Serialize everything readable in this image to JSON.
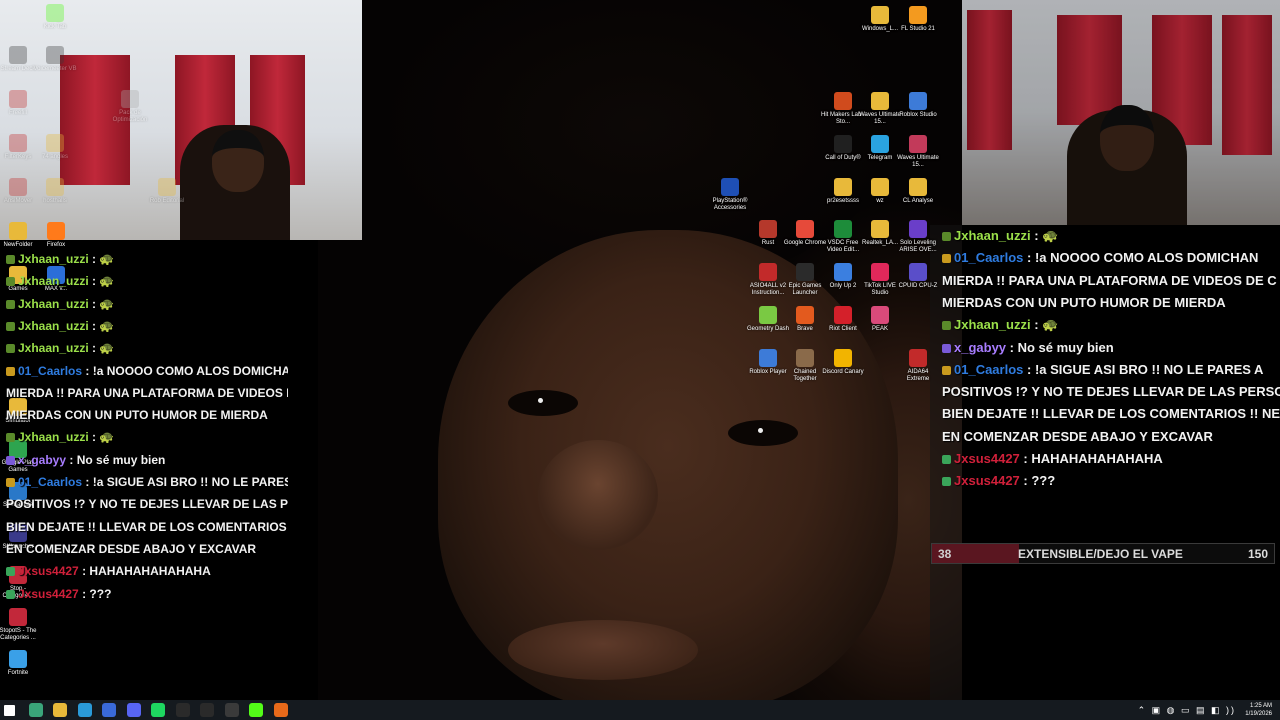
{
  "desktop_icons_top_right": [
    {
      "label": "Windows_L...",
      "color": "#e8b93a"
    },
    {
      "label": "FL Studio 21",
      "color": "#f39a1f"
    },
    {
      "label": "Hit Makers Lab - Sto...",
      "color": "#d04b1d"
    },
    {
      "label": "Waves Ultimate 15...",
      "color": "#e8b93a"
    },
    {
      "label": "Roblox Studio",
      "color": "#3d7bd8"
    },
    {
      "label": "Call of Duty®",
      "color": "#202020"
    },
    {
      "label": "Telegram",
      "color": "#2aa3e0"
    },
    {
      "label": "Waves Ultimate 15...",
      "color": "#c23a5a"
    },
    {
      "label": "PlayStation® Accessories",
      "color": "#1e4fb5"
    },
    {
      "label": "pr2esetssss",
      "color": "#e8b93a"
    },
    {
      "label": "wz",
      "color": "#e8b93a"
    },
    {
      "label": "CL Analyse",
      "color": "#e8b93a"
    },
    {
      "label": "Rust",
      "color": "#b5382b"
    },
    {
      "label": "Google Chrome",
      "color": "#e64a3a"
    },
    {
      "label": "VSDC Free Video Edit...",
      "color": "#1d8c3a"
    },
    {
      "label": "Realtek_LA...",
      "color": "#e8b93a"
    },
    {
      "label": "Solo Leveling ARISE OVE...",
      "color": "#6a3ec9"
    },
    {
      "label": "ASIO4ALL v2 Instruction...",
      "color": "#c22a2a"
    },
    {
      "label": "Epic Games Launcher",
      "color": "#2b2b2b"
    },
    {
      "label": "Only Up 2",
      "color": "#3b7fe0"
    },
    {
      "label": "TikTok LIVE Studio",
      "color": "#e0285a"
    },
    {
      "label": "CPUID CPU-Z",
      "color": "#5a4ec9"
    },
    {
      "label": "Geometry Dash",
      "color": "#7ac943"
    },
    {
      "label": "Brave",
      "color": "#e35a1e"
    },
    {
      "label": "Riot Client",
      "color": "#d4202a"
    },
    {
      "label": "PEAK",
      "color": "#d94a7a"
    },
    {
      "label": "Roblox Player",
      "color": "#3d7bd8"
    },
    {
      "label": "Chained Together",
      "color": "#8a6a4a"
    },
    {
      "label": "Discord Canary",
      "color": "#f2b400"
    },
    {
      "label": "AIDA64 Extreme",
      "color": "#c22a2a"
    }
  ],
  "desktop_icons_left": [
    {
      "label": "NewFolder",
      "color": "#e8b93a"
    },
    {
      "label": "Firefox",
      "color": "#ff7a1a"
    },
    {
      "label": "Games",
      "color": "#e8b93a"
    },
    {
      "label": "MAX v...",
      "color": "#2b6ed8"
    },
    {
      "label": "Simulator",
      "color": "#e8b93a"
    },
    {
      "label": "Google Play Games",
      "color": "#2ea44f"
    },
    {
      "label": "Subnautica",
      "color": "#2a78c8"
    },
    {
      "label": "SKlauncher",
      "color": "#3a3a8a"
    },
    {
      "label": "Stop - Categorie...",
      "color": "#c2283a"
    },
    {
      "label": "StopotS - The Categories ...",
      "color": "#c2283a"
    },
    {
      "label": "Fortnite",
      "color": "#3aa0e8"
    }
  ],
  "room_cam_icons": [
    {
      "label": "Kick Tab",
      "color": "#53fc18"
    },
    {
      "label": "Stream Deck",
      "color": "#3a3a3a"
    },
    {
      "label": "Voicemeeter VB",
      "color": "#3a3a3a"
    },
    {
      "label": "Freefill",
      "color": "#c22a2a"
    },
    {
      "label": "Pack de Optimización",
      "color": "#aaaaaa"
    },
    {
      "label": "FilterKeys",
      "color": "#c22a2a"
    },
    {
      "label": "74 angles",
      "color": "#e8b93a"
    },
    {
      "label": "AnsiMover",
      "color": "#c22a2a"
    },
    {
      "label": "hosthalls",
      "color": "#e8b93a"
    },
    {
      "label": "Rob Editorial",
      "color": "#e8b93a"
    }
  ],
  "chat_left": [
    {
      "user": "Jxhaan_uzzi",
      "color": "u-green",
      "msg": "🐢"
    },
    {
      "user": "Jxhaan_uzzi",
      "color": "u-green",
      "msg": "🐢"
    },
    {
      "user": "Jxhaan_uzzi",
      "color": "u-green",
      "msg": "🐢"
    },
    {
      "user": "Jxhaan_uzzi",
      "color": "u-green",
      "msg": "🐢"
    },
    {
      "user": "Jxhaan_uzzi",
      "color": "u-green",
      "msg": "🐢"
    },
    {
      "user": "01_Caarlos",
      "color": "u-blue",
      "msg": "!a NOOOO COMO ALOS DOMICHAN"
    },
    {
      "user": "",
      "color": "u-blue",
      "msg": "MIERDA !! PARA UNA PLATAFORMA DE VIDEOS DE C"
    },
    {
      "user": "",
      "color": "u-blue",
      "msg": "MIERDAS CON UN PUTO HUMOR DE MIERDA"
    },
    {
      "user": "Jxhaan_uzzi",
      "color": "u-green",
      "msg": "🐢"
    },
    {
      "user": "x_gabyy",
      "color": "u-purple",
      "msg": "No sé muy bien"
    },
    {
      "user": "01_Caarlos",
      "color": "u-blue",
      "msg": "!a SIGUE ASI BRO !! NO LE PARES"
    },
    {
      "user": "",
      "color": "u-blue",
      "msg": "POSITIVOS !? Y NO TE DEJES LLEVAR DE LAS PERSO"
    },
    {
      "user": "",
      "color": "u-blue",
      "msg": "BIEN DEJATE !! LLEVAR DE LOS COMENTARIOS !! NE"
    },
    {
      "user": "",
      "color": "u-blue",
      "msg": "EN COMENZAR DESDE ABAJO Y EXCAVAR"
    },
    {
      "user": "Jxsus4427",
      "color": "u-red",
      "msg": "HAHAHAHAHAHAHA"
    },
    {
      "user": "Jxsus4427",
      "color": "u-red",
      "msg": "???"
    }
  ],
  "chat_right": [
    {
      "user": "Jxhaan_uzzi",
      "color": "u-green",
      "msg": "🐢"
    },
    {
      "user": "01_Caarlos",
      "color": "u-blue",
      "msg": "!a NOOOO COMO ALOS DOMICHAN"
    },
    {
      "user": "",
      "color": "u-blue",
      "msg": "MIERDA !! PARA UNA PLATAFORMA DE VIDEOS DE C"
    },
    {
      "user": "",
      "color": "u-blue",
      "msg": "MIERDAS CON UN PUTO HUMOR DE MIERDA"
    },
    {
      "user": "Jxhaan_uzzi",
      "color": "u-green",
      "msg": "🐢"
    },
    {
      "user": "x_gabyy",
      "color": "u-purple",
      "msg": "No sé muy bien"
    },
    {
      "user": "01_Caarlos",
      "color": "u-blue",
      "msg": "!a SIGUE ASI BRO !! NO LE PARES A"
    },
    {
      "user": "",
      "color": "u-blue",
      "msg": "POSITIVOS !? Y NO TE DEJES LLEVAR DE LAS PERSON"
    },
    {
      "user": "",
      "color": "u-blue",
      "msg": "BIEN DEJATE !! LLEVAR DE LOS COMENTARIOS !! NEG"
    },
    {
      "user": "",
      "color": "u-blue",
      "msg": "EN COMENZAR DESDE ABAJO Y EXCAVAR"
    },
    {
      "user": "Jxsus4427",
      "color": "u-red",
      "msg": "HAHAHAHAHAHAHA"
    },
    {
      "user": "Jxsus4427",
      "color": "u-red",
      "msg": "???"
    }
  ],
  "goal_bar": {
    "current": "38",
    "label": "EXTENSIBLE/DEJO EL VAPE",
    "target": "150",
    "progress_fraction": 0.253
  },
  "taskbar": {
    "icons": [
      {
        "name": "start-icon",
        "color": "#ffffff"
      },
      {
        "name": "terminal-icon",
        "color": "#3aa57a"
      },
      {
        "name": "file-explorer-icon",
        "color": "#e8b93a"
      },
      {
        "name": "edge-icon",
        "color": "#2a9ad8"
      },
      {
        "name": "app-blue-icon",
        "color": "#3a6ad8"
      },
      {
        "name": "discord-icon",
        "color": "#5865f2"
      },
      {
        "name": "spotify-icon",
        "color": "#1ed760"
      },
      {
        "name": "media-icon",
        "color": "#2a2a2a"
      },
      {
        "name": "app-dark-icon",
        "color": "#2a2a2a"
      },
      {
        "name": "obs-icon",
        "color": "#3a3a3a"
      },
      {
        "name": "kick-icon",
        "color": "#53fc18"
      },
      {
        "name": "app-orange-icon",
        "color": "#e86a1a"
      }
    ],
    "time": "1:25 AM",
    "date": "1/19/2026",
    "tray_icons": "⌃ ▣ ◍ ▭ ▤ ◧ ))"
  }
}
